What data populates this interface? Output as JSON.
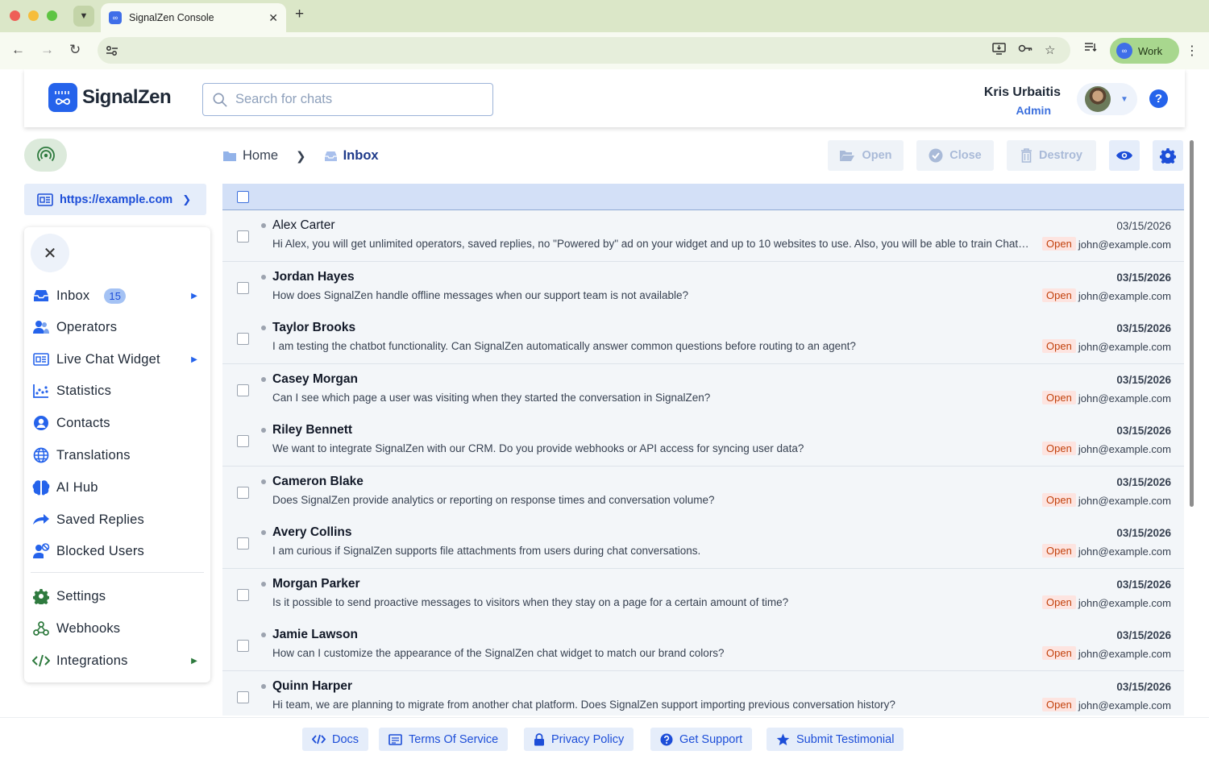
{
  "browser": {
    "tab_title": "SignalZen Console",
    "profile_label": "Work"
  },
  "header": {
    "brand": "SignalZen",
    "search_placeholder": "Search for chats",
    "user_name": "Kris Urbaitis",
    "user_role": "Admin"
  },
  "sidebar": {
    "site_url": "https://example.com",
    "items": [
      {
        "label": "Inbox",
        "badge": "15"
      },
      {
        "label": "Operators"
      },
      {
        "label": "Live Chat Widget"
      },
      {
        "label": "Statistics"
      },
      {
        "label": "Contacts"
      },
      {
        "label": "Translations"
      },
      {
        "label": "AI Hub"
      },
      {
        "label": "Saved Replies"
      },
      {
        "label": "Blocked Users"
      },
      {
        "label": "Settings"
      },
      {
        "label": "Webhooks"
      },
      {
        "label": "Integrations"
      }
    ]
  },
  "breadcrumb": {
    "home": "Home",
    "current": "Inbox"
  },
  "actions": {
    "open": "Open",
    "close": "Close",
    "destroy": "Destroy"
  },
  "chats": [
    {
      "name": "Alex Carter",
      "message": "Hi Alex, you will get unlimited operators, saved replies, no \"Powered by\" ad on your widget and up to 10 websites to use. Also, you will be able to train Chatbot on your website content and much more.",
      "date": "03/15/2026",
      "status": "Open",
      "email": "john@example.com"
    },
    {
      "name": "Jordan Hayes",
      "message": "How does SignalZen handle offline messages when our support team is not available?",
      "date": "03/15/2026",
      "status": "Open",
      "email": "john@example.com"
    },
    {
      "name": "Taylor Brooks",
      "message": "I am testing the chatbot functionality. Can SignalZen automatically answer common questions before routing to an agent?",
      "date": "03/15/2026",
      "status": "Open",
      "email": "john@example.com"
    },
    {
      "name": "Casey Morgan",
      "message": "Can I see which page a user was visiting when they started the conversation in SignalZen?",
      "date": "03/15/2026",
      "status": "Open",
      "email": "john@example.com"
    },
    {
      "name": "Riley Bennett",
      "message": "We want to integrate SignalZen with our CRM. Do you provide webhooks or API access for syncing user data?",
      "date": "03/15/2026",
      "status": "Open",
      "email": "john@example.com"
    },
    {
      "name": "Cameron Blake",
      "message": "Does SignalZen provide analytics or reporting on response times and conversation volume?",
      "date": "03/15/2026",
      "status": "Open",
      "email": "john@example.com"
    },
    {
      "name": "Avery Collins",
      "message": "I am curious if SignalZen supports file attachments from users during chat conversations.",
      "date": "03/15/2026",
      "status": "Open",
      "email": "john@example.com"
    },
    {
      "name": "Morgan Parker",
      "message": "Is it possible to send proactive messages to visitors when they stay on a page for a certain amount of time?",
      "date": "03/15/2026",
      "status": "Open",
      "email": "john@example.com"
    },
    {
      "name": "Jamie Lawson",
      "message": "How can I customize the appearance of the SignalZen chat widget to match our brand colors?",
      "date": "03/15/2026",
      "status": "Open",
      "email": "john@example.com"
    },
    {
      "name": "Quinn Harper",
      "message": "Hi team, we are planning to migrate from another chat platform. Does SignalZen support importing previous conversation history?",
      "date": "03/15/2026",
      "status": "Open",
      "email": "john@example.com"
    }
  ],
  "footer": {
    "docs": "Docs",
    "terms": "Terms Of Service",
    "privacy": "Privacy Policy",
    "support": "Get Support",
    "testimonial": "Submit Testimonial"
  },
  "colors": {
    "accent": "#2563eb",
    "status_open_bg": "#fde4e0",
    "status_open_text": "#c2410c",
    "browser_frame": "#dbe7c8"
  }
}
